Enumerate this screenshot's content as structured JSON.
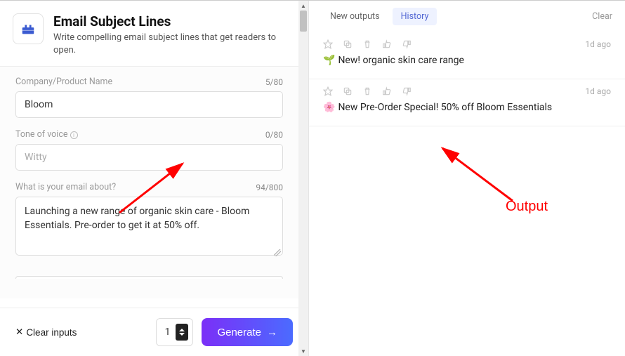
{
  "header": {
    "title": "Email Subject Lines",
    "subtitle": "Write compelling email subject lines that get readers to open."
  },
  "fields": {
    "company": {
      "label": "Company/Product Name",
      "value": "Bloom",
      "counter": "5/80"
    },
    "tone": {
      "label": "Tone of voice",
      "placeholder": "Witty",
      "value": "",
      "counter": "0/80"
    },
    "about": {
      "label": "What is your email about?",
      "value": "Launching a new range of organic skin care - Bloom Essentials. Pre-order to get it at 50% off.",
      "counter": "94/800"
    }
  },
  "controls": {
    "clear_inputs": "Clear inputs",
    "quantity": "1",
    "generate": "Generate"
  },
  "tabs": {
    "new_outputs": "New outputs",
    "history": "History",
    "clear": "Clear"
  },
  "outputs": [
    {
      "time": "1d ago",
      "emoji": "🌱",
      "text": " New! organic skin care range"
    },
    {
      "time": "1d ago",
      "emoji": "🌸",
      "text": "New Pre-Order Special! 50% off Bloom Essentials"
    }
  ],
  "annotation": {
    "output_label": "Output"
  }
}
